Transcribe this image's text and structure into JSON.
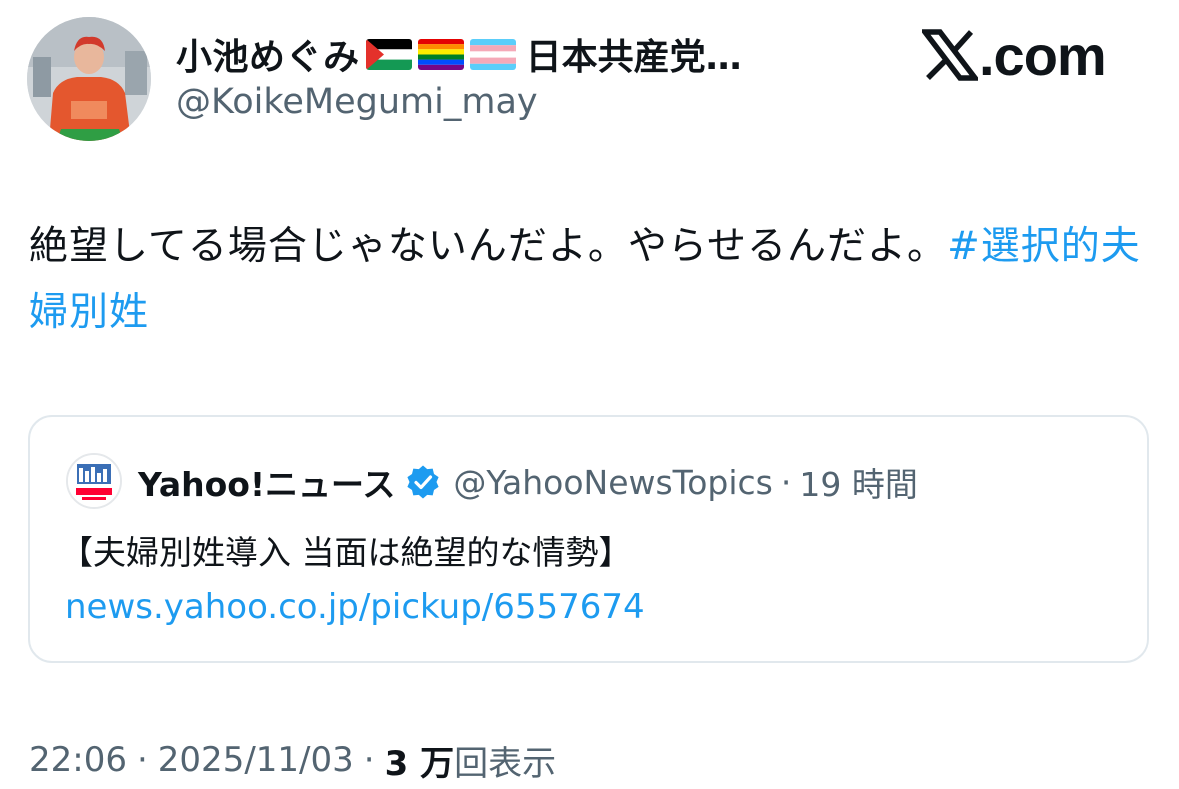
{
  "author": {
    "display_name": "小池めぐみ",
    "flags": [
      "palestine-flag-icon",
      "rainbow-flag-icon",
      "transgender-flag-icon"
    ],
    "party_truncated": "日本共産党…",
    "handle": "@KoikeMegumi_may",
    "avatar_alt": "profile-photo"
  },
  "brand": {
    "text": ".com",
    "mark": "x-logo-icon"
  },
  "tweet": {
    "text": "絶望してる場合じゃないんだよ。やらせるんだよ。",
    "hashtag": "#選択的夫婦別姓"
  },
  "quote": {
    "name": "Yahoo!ニュース",
    "verified": true,
    "handle": "@YahooNewsTopics",
    "separator": "·",
    "time": "19 時間",
    "body": "【夫婦別姓導入 当面は絶望的な情勢】",
    "link": "news.yahoo.co.jp/pickup/6557674"
  },
  "meta": {
    "time": "22:06",
    "dot": "·",
    "date": "2025/11/03",
    "views_count": "3 万",
    "views_label": "回表示"
  },
  "colors": {
    "link": "#1d9bf0",
    "secondary_text": "#536471",
    "primary_text": "#0f1419",
    "border": "#e1e8ed"
  }
}
